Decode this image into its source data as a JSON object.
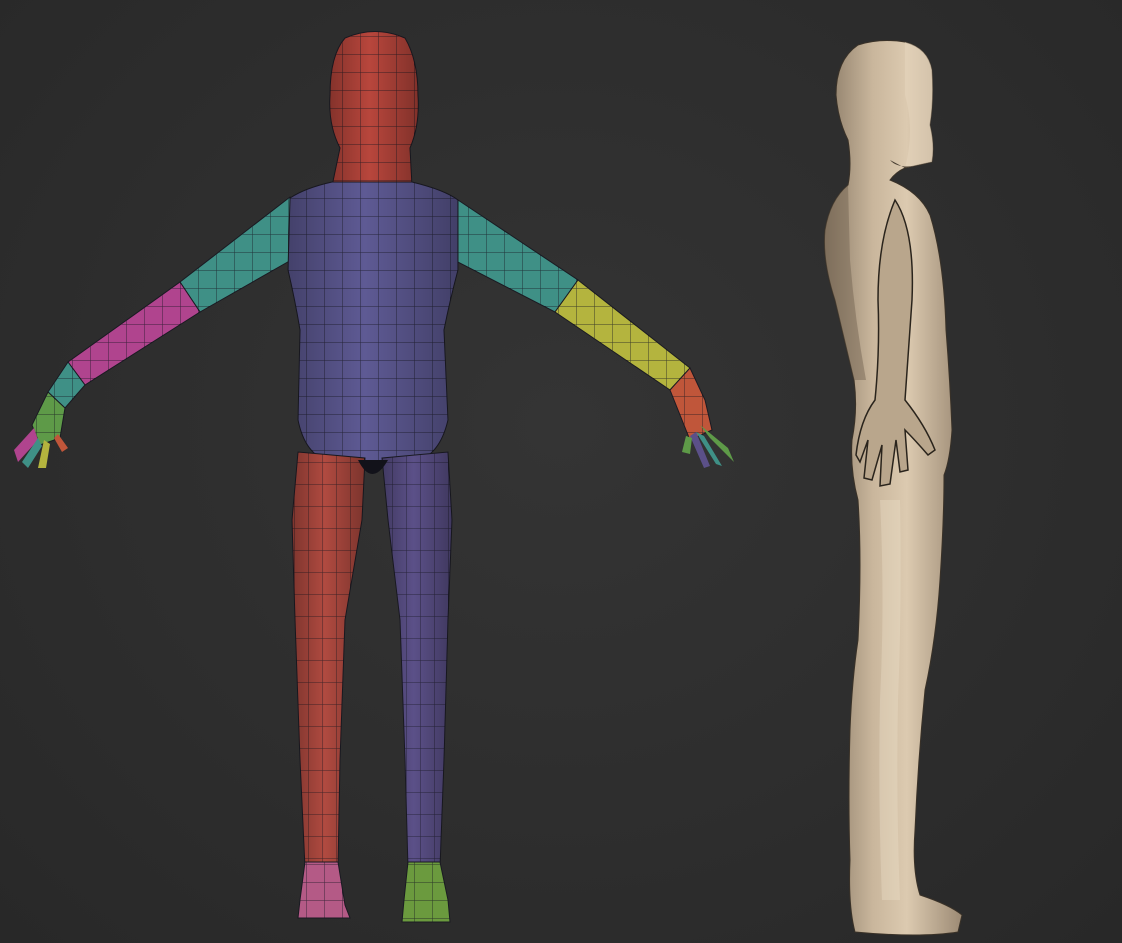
{
  "scene": {
    "background_color": "#2e2e2e",
    "models": [
      {
        "id": "front",
        "view": "front",
        "shading": "polygroups-wireframe",
        "polygroup_colors": {
          "head_neck": "#b8463c",
          "torso": "#5e5a94",
          "right_leg": "#b04a40",
          "left_leg": "#5b5088",
          "upper_arm": "#3f9086",
          "forearm_right": "#b0448e",
          "forearm_left": "#b4b43e",
          "hand_right": "#5e9a48",
          "hand_left": "#c0563a",
          "foot_right": "#b45a86",
          "foot_left": "#6b9a3e"
        },
        "wire_color": "#1a1a22"
      },
      {
        "id": "side",
        "view": "side",
        "shading": "flat-clay",
        "material_color": "#c8b49a"
      }
    ]
  }
}
